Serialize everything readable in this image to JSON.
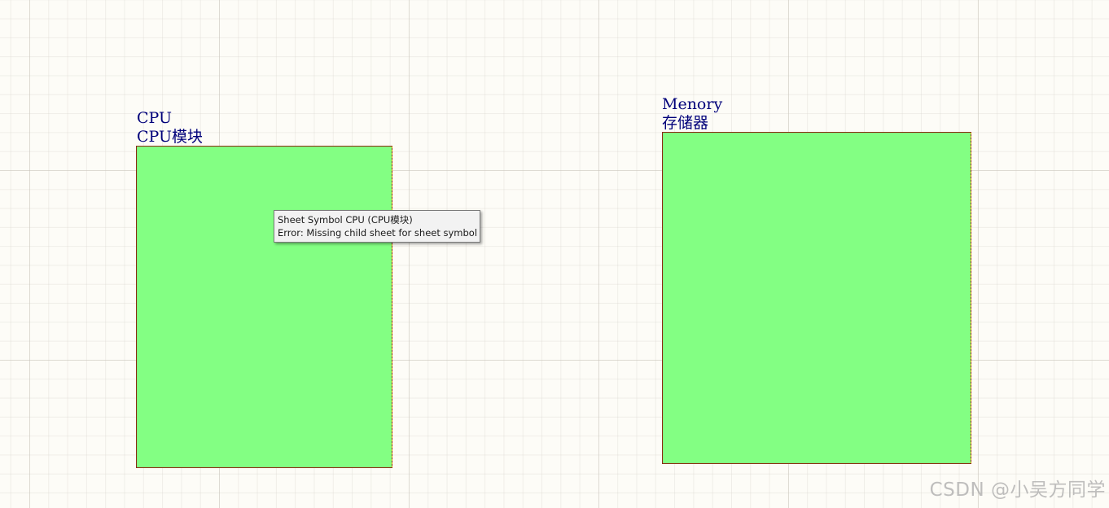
{
  "sheet_symbols": [
    {
      "designator": "CPU",
      "file_name": "CPU模块"
    },
    {
      "designator": "Menory",
      "file_name": "存储器"
    }
  ],
  "tooltip": {
    "line1": "Sheet Symbol CPU (CPU模块)",
    "line2": "Error: Missing child sheet for sheet symbol"
  },
  "watermark": "CSDN @小吴方同学",
  "colors": {
    "canvas_background": "#fdfcf7",
    "sheet_fill": "#83ff83",
    "sheet_border": "#8b2a10",
    "label_text": "#00007a"
  }
}
